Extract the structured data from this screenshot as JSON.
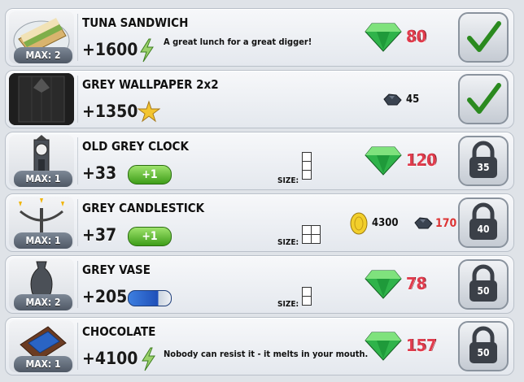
{
  "items": [
    {
      "name": "TUNA SANDWICH",
      "max": "MAX: 2",
      "value": "+1600",
      "value_icon": "lightning-icon",
      "description": "A great lunch for a great digger!",
      "currency": "gem-icon",
      "price": "80",
      "action": "check-icon"
    },
    {
      "name": "GREY WALLPAPER 2x2",
      "max": "",
      "value": "+1350",
      "value_icon": "star-icon",
      "description": "",
      "currency": "coal-icon",
      "price": "45",
      "action": "check-icon"
    },
    {
      "name": "OLD GREY CLOCK",
      "max": "MAX: 1",
      "value": "+33",
      "value_icon": "energy-pill",
      "energy_label": "+1",
      "size_label": "SIZE:",
      "currency": "gem-icon",
      "price": "120",
      "action": "lock-icon",
      "lock_level": "35"
    },
    {
      "name": "GREY CANDLESTICK",
      "max": "MAX: 1",
      "value": "+37",
      "value_icon": "energy-pill",
      "energy_label": "+1",
      "size_label": "SIZE:",
      "price_coins": "4300",
      "price_coal": "170",
      "action": "lock-icon",
      "lock_level": "40"
    },
    {
      "name": "GREY VASE",
      "max": "MAX: 2",
      "value": "+205",
      "value_icon": "blue-pill",
      "size_label": "SIZE:",
      "currency": "gem-icon",
      "price": "78",
      "action": "lock-icon",
      "lock_level": "50"
    },
    {
      "name": "CHOCOLATE",
      "max": "MAX: 1",
      "value": "+4100",
      "value_icon": "lightning-icon",
      "description": "Nobody can resist it - it melts in your mouth.",
      "currency": "gem-icon",
      "price": "157",
      "action": "lock-icon",
      "lock_level": "50"
    }
  ],
  "colors": {
    "price_red": "#e03b4c",
    "gem_green": "#2fb34a",
    "check_green": "#2b8a1f",
    "lock_dark": "#3b4048"
  }
}
